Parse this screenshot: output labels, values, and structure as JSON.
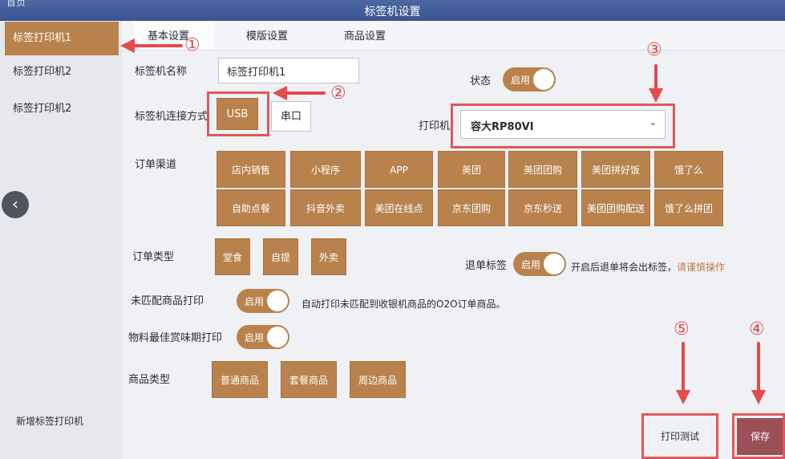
{
  "header": {
    "title": "标签机设置",
    "back_text": "首页"
  },
  "sidebar": {
    "items": [
      {
        "label": "标签打印机1"
      },
      {
        "label": "标签打印机2"
      },
      {
        "label": "标签打印机2"
      }
    ],
    "add_label": "新增标签打印机"
  },
  "tabs": [
    {
      "label": "基本设置"
    },
    {
      "label": "模版设置"
    },
    {
      "label": "商品设置"
    }
  ],
  "form": {
    "name_label": "标签机名称",
    "name_value": "标签打印机1",
    "status_label": "状态",
    "status_toggle": "启用",
    "connect_label": "标签机连接方式",
    "connect_usb": "USB",
    "connect_serial": "串口",
    "printer_label": "打印机",
    "printer_value": "容大RP80VI",
    "channel_label": "订单渠道",
    "channels_row1": [
      "店内销售",
      "小程序",
      "APP",
      "美团",
      "美团团购",
      "美团拼好饭",
      "饿了么"
    ],
    "channels_row2": [
      "自助点餐",
      "抖音外卖",
      "美团在线点",
      "京东团购",
      "京东秒送",
      "美团团购配送",
      "饿了么拼团"
    ],
    "order_type_label": "订单类型",
    "order_types": [
      "堂食",
      "自提",
      "外卖"
    ],
    "refund_label": "退单标签",
    "refund_toggle": "启用",
    "refund_hint_a": "开启后退单将会出标签，",
    "refund_hint_b": "请谨慎操作",
    "unmatched_label": "未匹配商品打印",
    "unmatched_toggle": "启用",
    "unmatched_hint": "自动打印未匹配到收银机商品的O2O订单商品。",
    "bestbefore_label": "物料最佳赏味期打印",
    "bestbefore_toggle": "启用",
    "product_type_label": "商品类型",
    "product_types": [
      "普通商品",
      "套餐商品",
      "周边商品"
    ]
  },
  "footer": {
    "test_print": "打印测试",
    "save": "保存"
  },
  "annotations": {
    "n1": "①",
    "n2": "②",
    "n3": "③",
    "n4": "④",
    "n5": "⑤"
  },
  "colors": {
    "accent": "#b9824c",
    "header": "#3f5894",
    "highlight": "#e25757"
  }
}
